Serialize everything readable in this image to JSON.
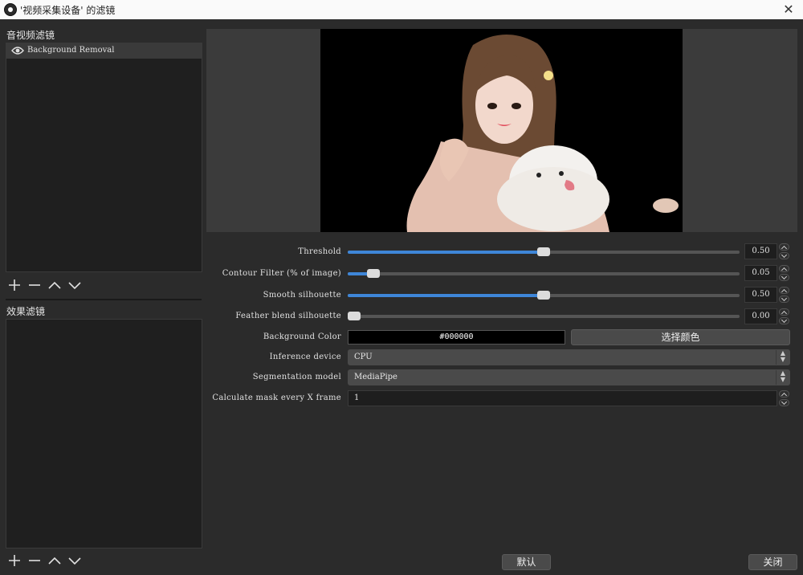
{
  "window": {
    "title": "'视频采集设备' 的滤镜",
    "close_glyph": "✕"
  },
  "audio_video_filters": {
    "label": "音视频滤镜",
    "items": [
      {
        "label": "Background Removal",
        "visible": true
      }
    ]
  },
  "effect_filters": {
    "label": "效果滤镜",
    "items": []
  },
  "toolbar_icons": [
    "add-icon",
    "remove-icon",
    "move-up-icon",
    "move-down-icon"
  ],
  "properties": {
    "threshold": {
      "label": "Threshold",
      "value": "0.50",
      "fraction": 0.5
    },
    "contour_filter": {
      "label": "Contour Filter (% of image)",
      "value": "0.05",
      "fraction": 0.065
    },
    "smooth_silhouette": {
      "label": "Smooth silhouette",
      "value": "0.50",
      "fraction": 0.5
    },
    "feather_blend": {
      "label": "Feather blend silhouette",
      "value": "0.00",
      "fraction": 0.0
    },
    "background_color": {
      "label": "Background Color",
      "value": "#000000",
      "button": "选择颜色"
    },
    "inference_device": {
      "label": "Inference device",
      "value": "CPU"
    },
    "segmentation_model": {
      "label": "Segmentation model",
      "value": "MediaPipe"
    },
    "calc_mask": {
      "label": "Calculate mask every X frame",
      "value": "1"
    }
  },
  "buttons": {
    "defaults": "默认",
    "close": "关闭"
  },
  "colors": {
    "accent": "#3e86d8",
    "background": "#2b2b2b",
    "panel": "#1f1f1f"
  }
}
